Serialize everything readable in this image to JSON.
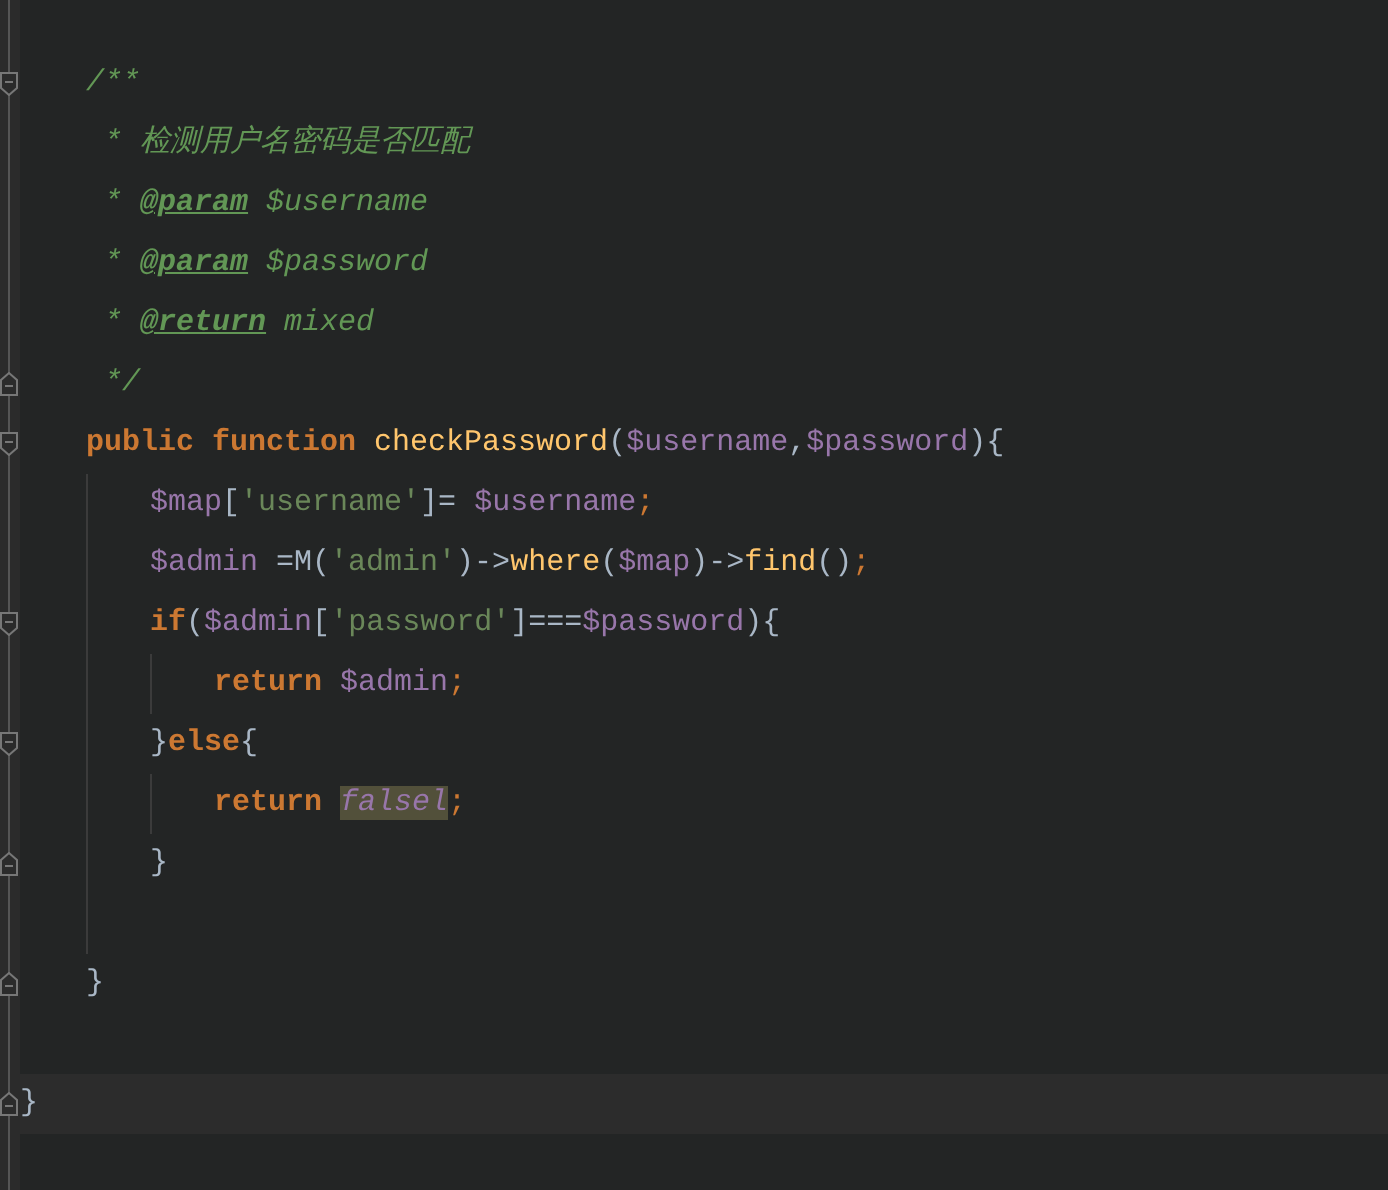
{
  "editor": {
    "lines": [
      {
        "kind": "block",
        "children": [
          {
            "kind": "code",
            "fold_open": true,
            "tokens": [
              {
                "text": "/**",
                "kind": "comment"
              }
            ]
          },
          {
            "kind": "code",
            "tokens": [
              {
                "text": " * 检测用户名密码是否匹配",
                "kind": "comment"
              }
            ]
          },
          {
            "kind": "code",
            "tokens": [
              {
                "text": " * ",
                "kind": "comment"
              },
              {
                "text": "@param",
                "kind": "doctag"
              },
              {
                "text": " $username",
                "kind": "comment"
              }
            ]
          },
          {
            "kind": "code",
            "tokens": [
              {
                "text": " * ",
                "kind": "comment"
              },
              {
                "text": "@param",
                "kind": "doctag"
              },
              {
                "text": " $password",
                "kind": "comment"
              }
            ]
          },
          {
            "kind": "code",
            "tokens": [
              {
                "text": " * ",
                "kind": "comment"
              },
              {
                "text": "@return",
                "kind": "doctag"
              },
              {
                "text": " mixed",
                "kind": "comment"
              }
            ]
          },
          {
            "kind": "code",
            "fold_close": true,
            "tokens": [
              {
                "text": " */",
                "kind": "comment"
              }
            ]
          },
          {
            "kind": "code",
            "fold_open": true,
            "tokens": [
              {
                "text": "public function ",
                "kind": "keyword"
              },
              {
                "text": "checkPassword",
                "kind": "function"
              },
              {
                "text": "(",
                "kind": "punct"
              },
              {
                "text": "$username",
                "kind": "variable"
              },
              {
                "text": ",",
                "kind": "punct"
              },
              {
                "text": "$password",
                "kind": "variable"
              },
              {
                "text": "){",
                "kind": "punct"
              }
            ],
            "children": [
              {
                "kind": "code",
                "tokens": [
                  {
                    "text": "$map",
                    "kind": "variable"
                  },
                  {
                    "text": "[",
                    "kind": "punct"
                  },
                  {
                    "text": "'username'",
                    "kind": "string"
                  },
                  {
                    "text": "]= ",
                    "kind": "punct"
                  },
                  {
                    "text": "$username",
                    "kind": "variable"
                  },
                  {
                    "text": ";",
                    "kind": "semi"
                  }
                ]
              },
              {
                "kind": "code",
                "tokens": [
                  {
                    "text": "$admin",
                    "kind": "variable"
                  },
                  {
                    "text": " =M(",
                    "kind": "punct"
                  },
                  {
                    "text": "'admin'",
                    "kind": "string"
                  },
                  {
                    "text": ")->",
                    "kind": "punct"
                  },
                  {
                    "text": "where",
                    "kind": "function"
                  },
                  {
                    "text": "(",
                    "kind": "punct"
                  },
                  {
                    "text": "$map",
                    "kind": "variable"
                  },
                  {
                    "text": ")->",
                    "kind": "punct"
                  },
                  {
                    "text": "find",
                    "kind": "function"
                  },
                  {
                    "text": "()",
                    "kind": "punct"
                  },
                  {
                    "text": ";",
                    "kind": "semi"
                  }
                ]
              },
              {
                "kind": "code",
                "fold_open": true,
                "tokens": [
                  {
                    "text": "if",
                    "kind": "keyword"
                  },
                  {
                    "text": "(",
                    "kind": "punct"
                  },
                  {
                    "text": "$admin",
                    "kind": "variable"
                  },
                  {
                    "text": "[",
                    "kind": "punct"
                  },
                  {
                    "text": "'password'",
                    "kind": "string"
                  },
                  {
                    "text": "]===",
                    "kind": "punct"
                  },
                  {
                    "text": "$password",
                    "kind": "variable"
                  },
                  {
                    "text": "){",
                    "kind": "punct"
                  }
                ],
                "children": [
                  {
                    "kind": "code",
                    "tokens": [
                      {
                        "text": "return ",
                        "kind": "keyword"
                      },
                      {
                        "text": "$admin",
                        "kind": "variable"
                      },
                      {
                        "text": ";",
                        "kind": "semi"
                      }
                    ]
                  }
                ]
              },
              {
                "kind": "code",
                "fold_open": true,
                "tokens": [
                  {
                    "text": "}",
                    "kind": "punct"
                  },
                  {
                    "text": "else",
                    "kind": "keyword"
                  },
                  {
                    "text": "{",
                    "kind": "punct"
                  }
                ],
                "children": [
                  {
                    "kind": "code",
                    "tokens": [
                      {
                        "text": "return ",
                        "kind": "keyword"
                      },
                      {
                        "text": "falsel",
                        "kind": "highlight"
                      },
                      {
                        "text": ";",
                        "kind": "semi"
                      }
                    ]
                  }
                ]
              },
              {
                "kind": "code",
                "fold_close": true,
                "tokens": [
                  {
                    "text": "}",
                    "kind": "punct"
                  }
                ]
              },
              {
                "kind": "blank"
              }
            ]
          },
          {
            "kind": "code",
            "fold_close": true,
            "tokens": [
              {
                "text": "}",
                "kind": "punct"
              }
            ]
          },
          {
            "kind": "blank"
          }
        ]
      },
      {
        "kind": "code",
        "fold_close": true,
        "current": true,
        "tokens": [
          {
            "text": "}",
            "kind": "punct"
          }
        ]
      }
    ]
  }
}
